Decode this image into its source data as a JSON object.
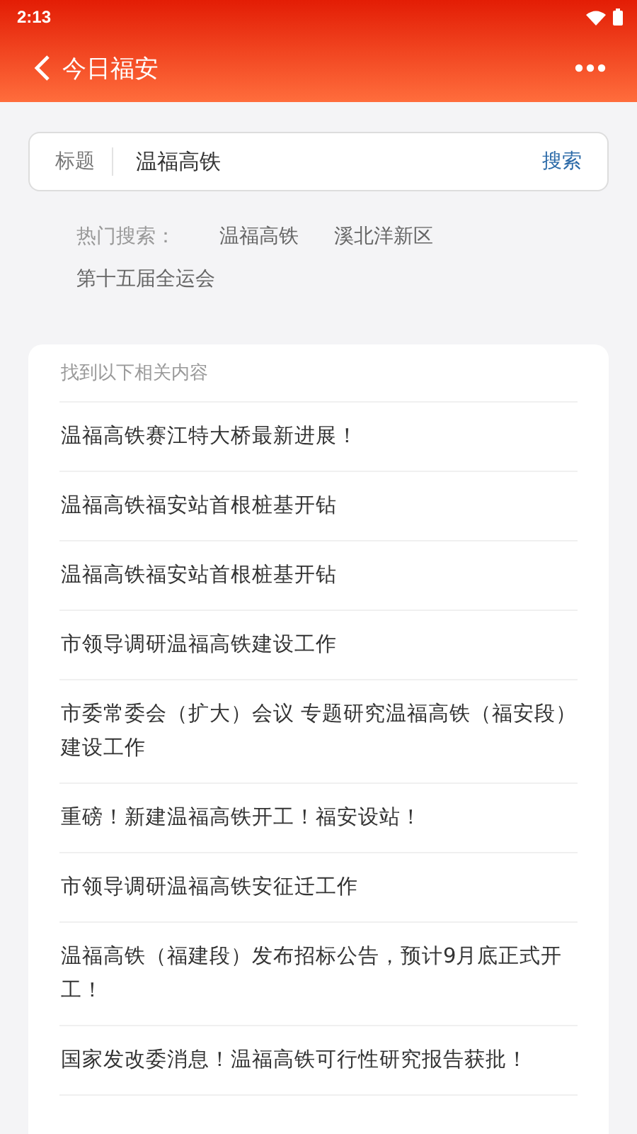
{
  "status_bar": {
    "time": "2:13"
  },
  "app_bar": {
    "title": "今日福安"
  },
  "search": {
    "label": "标题",
    "value": "温福高铁",
    "button": "搜索"
  },
  "hot_search": {
    "label": "热门搜索：",
    "terms": [
      "温福高铁",
      "溪北洋新区",
      "第十五届全运会"
    ]
  },
  "results": {
    "heading": "找到以下相关内容",
    "items": [
      {
        "title": "温福高铁赛江特大桥最新进展！"
      },
      {
        "title": "温福高铁福安站首根桩基开钻"
      },
      {
        "title": "温福高铁福安站首根桩基开钻"
      },
      {
        "title": "市领导调研温福高铁建设工作"
      },
      {
        "title": "市委常委会（扩大）会议 专题研究温福高铁（福安段）建设工作"
      },
      {
        "title": "重磅！新建温福高铁开工！福安设站！"
      },
      {
        "title": "市领导调研温福高铁安征迁工作"
      },
      {
        "title": "温福高铁（福建段）发布招标公告，预计9月底正式开工！"
      },
      {
        "title": "国家发改委消息！温福高铁可行性研究报告获批！"
      }
    ]
  }
}
